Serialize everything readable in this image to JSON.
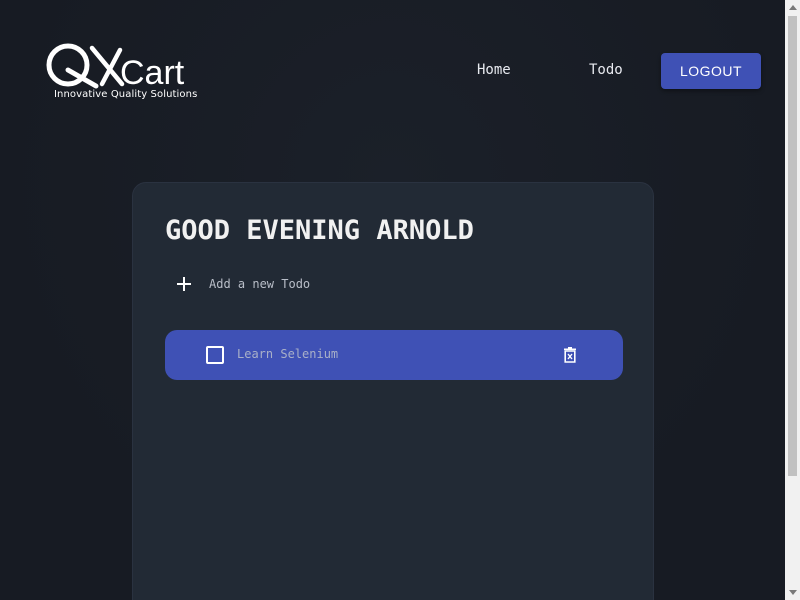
{
  "header": {
    "logo_text": "QKCart",
    "logo_tagline": "Innovative Quality Solutions",
    "nav": [
      {
        "label": "Home"
      },
      {
        "label": "Todo"
      }
    ],
    "logout_label": "LOGOUT"
  },
  "main": {
    "greeting": "GOOD EVENING ARNOLD",
    "add_todo_placeholder": "Add a new Todo",
    "todos": [
      {
        "text": "Learn Selenium",
        "completed": false
      }
    ]
  },
  "colors": {
    "background": "#181d25",
    "card": "#222a35",
    "accent": "#3f51b5"
  },
  "icons": {
    "add": "plus-icon",
    "todo_checkbox": "checkbox-icon",
    "delete": "trash-icon"
  }
}
